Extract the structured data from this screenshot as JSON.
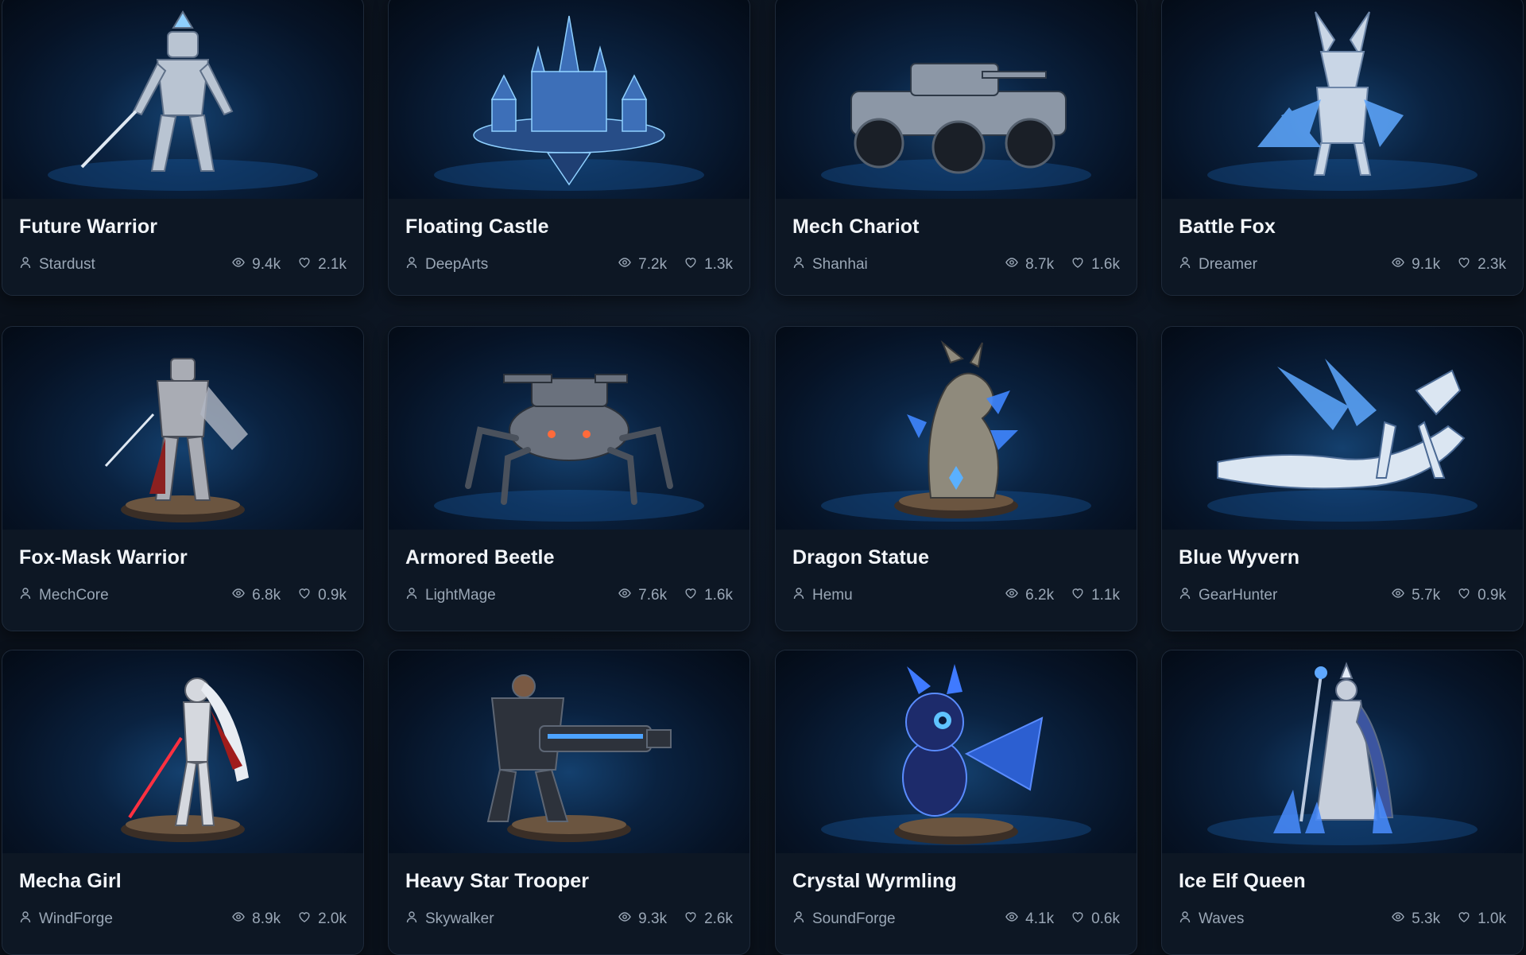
{
  "cards": [
    {
      "title": "Future Warrior",
      "author": "Stardust",
      "views": "9.4k",
      "likes": "2.1k",
      "subject": "mecha",
      "thumbnail": "silver mecha warrior with sword"
    },
    {
      "title": "Floating Castle",
      "author": "DeepArts",
      "views": "7.2k",
      "likes": "1.3k",
      "subject": "castle",
      "thumbnail": "floating crystal castle"
    },
    {
      "title": "Mech Chariot",
      "author": "Shanhai",
      "views": "8.7k",
      "likes": "1.6k",
      "subject": "vehicle",
      "thumbnail": "armored six-wheel vehicle"
    },
    {
      "title": "Battle Fox",
      "author": "Dreamer",
      "views": "9.1k",
      "likes": "2.3k",
      "subject": "fox",
      "thumbnail": "crystal armored fox"
    },
    {
      "title": "Fox-Mask Warrior",
      "author": "MechCore",
      "views": "6.8k",
      "likes": "0.9k",
      "subject": "samurai",
      "thumbnail": "samurai figure on pedestal"
    },
    {
      "title": "Armored Beetle",
      "author": "LightMage",
      "views": "7.6k",
      "likes": "1.6k",
      "subject": "spider",
      "thumbnail": "spider-legged tank"
    },
    {
      "title": "Dragon Statue",
      "author": "Hemu",
      "views": "6.2k",
      "likes": "1.1k",
      "subject": "dragonbust",
      "thumbnail": "dragon head bust"
    },
    {
      "title": "Blue Wyvern",
      "author": "GearHunter",
      "views": "5.7k",
      "likes": "0.9k",
      "subject": "wyvern",
      "thumbnail": "crystal blue wyvern"
    },
    {
      "title": "Mecha Girl",
      "author": "WindForge",
      "views": "8.9k",
      "likes": "2.0k",
      "subject": "girl",
      "thumbnail": "white haired mecha girl figure"
    },
    {
      "title": "Heavy Star Trooper",
      "author": "Skywalker",
      "views": "9.3k",
      "likes": "2.6k",
      "subject": "trooper",
      "thumbnail": "heavy armored trooper with gatling"
    },
    {
      "title": "Crystal Wyrmling",
      "author": "SoundForge",
      "views": "4.1k",
      "likes": "0.6k",
      "subject": "wyrmling",
      "thumbnail": "baby crystal dragon on pedestal"
    },
    {
      "title": "Ice Elf Queen",
      "author": "Waves",
      "views": "5.3k",
      "likes": "1.0k",
      "subject": "queen",
      "thumbnail": "ice elf queen with staff"
    }
  ],
  "icons": {
    "author": "user-icon",
    "views": "eye-icon",
    "likes": "heart-icon"
  },
  "colors": {
    "background": "#0a111b",
    "card": "#0d1724",
    "accent": "#2f86ff",
    "text": "#f2f5f9",
    "muted": "#9aa7b6"
  }
}
